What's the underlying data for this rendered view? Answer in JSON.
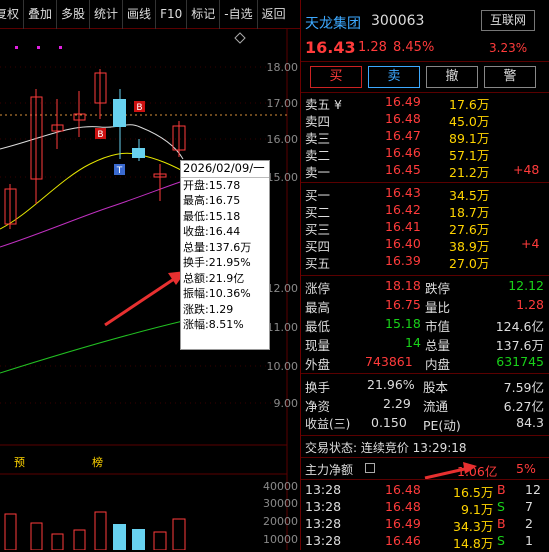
{
  "toolbar": [
    "复权",
    "叠加",
    "多股",
    "统计",
    "画线",
    "F10",
    "标记",
    "-自选",
    "返回"
  ],
  "chart": {
    "price_ticks": [
      "18.00",
      "17.00",
      "16.00",
      "15.00",
      "12.00",
      "11.00",
      "10.00",
      "9.00"
    ],
    "volume_ticks": [
      "40000",
      "30000",
      "20000",
      "10000"
    ],
    "markers": {
      "yu": "预",
      "bang": "榜",
      "b": "B",
      "t": "T"
    },
    "tooltip": {
      "date": "2026/02/09/一",
      "open": "开盘:15.78",
      "high": "最高:16.75",
      "low": "最低:15.18",
      "close": "收盘:16.44",
      "volume": "总量:137.6万",
      "turnover": "换手:21.95%",
      "amount": "总额:21.9亿",
      "amplitude": "振幅:10.36%",
      "change": "涨跌:1.29",
      "pct": "涨幅:8.51%"
    }
  },
  "stock": {
    "name": "天龙集团",
    "code": "300063",
    "sector": "互联网",
    "sector_pct": "3.23%",
    "price": "16.43",
    "change": "1.28",
    "pct": "8.45%"
  },
  "buttons": {
    "buy": "买",
    "sell": "卖",
    "cancel": "撤",
    "alert": "警"
  },
  "asks": [
    {
      "label": "卖五 ¥",
      "price": "16.49",
      "vol": "17.6万",
      "delta": ""
    },
    {
      "label": "卖四",
      "price": "16.48",
      "vol": "45.0万",
      "delta": ""
    },
    {
      "label": "卖三",
      "price": "16.47",
      "vol": "89.1万",
      "delta": ""
    },
    {
      "label": "卖二",
      "price": "16.46",
      "vol": "57.1万",
      "delta": ""
    },
    {
      "label": "卖一",
      "price": "16.45",
      "vol": "21.2万",
      "delta": "+48"
    }
  ],
  "bids": [
    {
      "label": "买一",
      "price": "16.43",
      "vol": "34.5万",
      "delta": ""
    },
    {
      "label": "买二",
      "price": "16.42",
      "vol": "18.7万",
      "delta": ""
    },
    {
      "label": "买三",
      "price": "16.41",
      "vol": "27.6万",
      "delta": ""
    },
    {
      "label": "买四",
      "price": "16.40",
      "vol": "38.9万",
      "delta": "+4"
    },
    {
      "label": "买五",
      "price": "16.39",
      "vol": "27.0万",
      "delta": ""
    }
  ],
  "stats": [
    {
      "l1": "涨停",
      "v1": "18.18",
      "c1": "red",
      "l2": "跌停",
      "v2": "12.12",
      "c2": "green"
    },
    {
      "l1": "最高",
      "v1": "16.75",
      "c1": "red",
      "l2": "量比",
      "v2": "1.28",
      "c2": "red"
    },
    {
      "l1": "最低",
      "v1": "15.18",
      "c1": "green",
      "l2": "市值",
      "v2": "124.6亿",
      "c2": "white"
    },
    {
      "l1": "现量",
      "v1": "14",
      "c1": "green",
      "l2": "总量",
      "v2": "137.6万",
      "c2": "white"
    },
    {
      "l1": "外盘",
      "v1": "743861",
      "c1": "red",
      "l2": "内盘",
      "v2": "631745",
      "c2": "green"
    }
  ],
  "stats2": [
    {
      "l1": "换手",
      "v1": "21.96%",
      "l2": "股本",
      "v2": "7.59亿"
    },
    {
      "l1": "净资",
      "v1": "2.29",
      "l2": "流通",
      "v2": "6.27亿"
    },
    {
      "l1": "收益(三)",
      "v1": "0.150",
      "l2": "PE(动)",
      "v2": "84.3"
    }
  ],
  "status": "交易状态: 连续竞价 13:29:18",
  "mainflow": {
    "label": "主力净额",
    "value": "1.06亿",
    "pct": "5%"
  },
  "ticks": [
    {
      "time": "13:28",
      "price": "16.48",
      "vol": "16.5万",
      "side": "B",
      "n": "12"
    },
    {
      "time": "13:28",
      "price": "16.48",
      "vol": "9.1万",
      "side": "S",
      "n": "7"
    },
    {
      "time": "13:28",
      "price": "16.49",
      "vol": "34.3万",
      "side": "B",
      "n": "2"
    },
    {
      "time": "13:28",
      "price": "16.46",
      "vol": "14.8万",
      "side": "S",
      "n": "1"
    }
  ],
  "colors": {
    "up": "#ff3b3b",
    "down": "#19d119",
    "bg": "#000000",
    "accent": "#ffd400"
  }
}
